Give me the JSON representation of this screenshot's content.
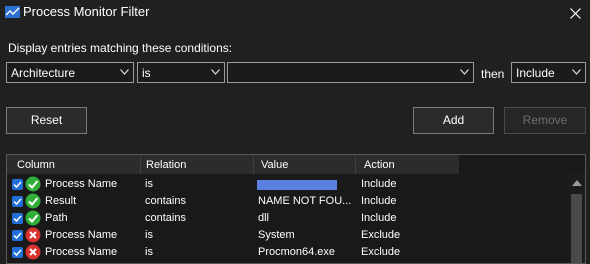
{
  "window": {
    "title": "Process Monitor Filter"
  },
  "prompt": "Display entries matching these conditions:",
  "condition": {
    "column": "Architecture",
    "relation": "is",
    "value": "",
    "then_label": "then",
    "action": "Include"
  },
  "buttons": {
    "reset": "Reset",
    "add": "Add",
    "remove": "Remove"
  },
  "table": {
    "headers": [
      "Column",
      "Relation",
      "Value",
      "Action"
    ],
    "rows": [
      {
        "column": "Process Name",
        "relation": "is",
        "value": "",
        "action": "Include",
        "status": "include",
        "checked": true
      },
      {
        "column": "Result",
        "relation": "contains",
        "value": "NAME NOT FOU...",
        "action": "Include",
        "status": "include",
        "checked": true
      },
      {
        "column": "Path",
        "relation": "contains",
        "value": "dll",
        "action": "Include",
        "status": "include",
        "checked": true
      },
      {
        "column": "Process Name",
        "relation": "is",
        "value": "System",
        "action": "Exclude",
        "status": "exclude",
        "checked": true
      },
      {
        "column": "Process Name",
        "relation": "is",
        "value": "Procmon64.exe",
        "action": "Exclude",
        "status": "exclude",
        "checked": true
      }
    ]
  },
  "colors": {
    "include_icon": "#2fae3a",
    "exclude_icon": "#d8322f",
    "checkbox": "#1f6fd6",
    "selection": "#5a7fe0"
  }
}
